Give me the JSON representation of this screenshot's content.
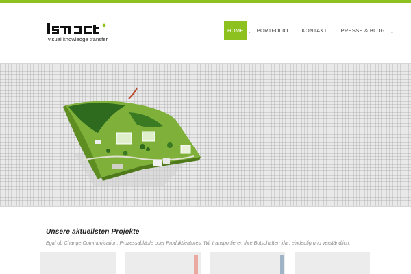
{
  "logo": {
    "wordmark": "isact",
    "tagline": "visual knowledge transfer",
    "accent_color": "#8cc11f"
  },
  "nav": {
    "items": [
      {
        "label": "HOME",
        "active": true
      },
      {
        "label": "PORTFOLIO",
        "active": false
      },
      {
        "label": "KONTAKT",
        "active": false
      },
      {
        "label": "PRESSE & BLOG",
        "active": false
      }
    ],
    "separator": "."
  },
  "hero": {
    "illustration": "3d-landscape-map-icon"
  },
  "projects": {
    "title": "Unsere aktuellsten Projekte",
    "description": "Egal ob Change Communication, Prozessabläufe oder Produktfeatures: Wir transportieren Ihre Botschaften klar, eindeutig und verständlich."
  },
  "colors": {
    "brand_green": "#8cc11f",
    "grid_background": "#e9e9e9"
  }
}
